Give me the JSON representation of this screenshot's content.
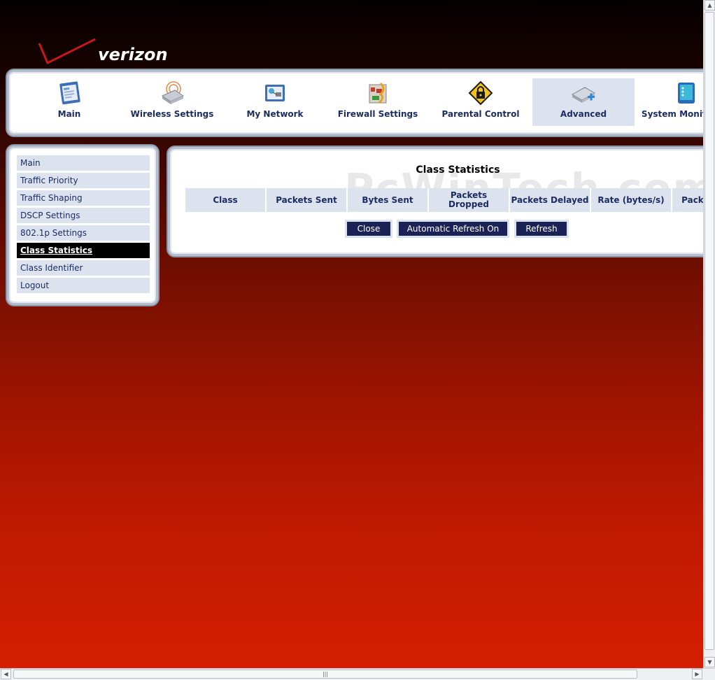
{
  "logo": {
    "text": "verizon"
  },
  "nav": {
    "items": [
      {
        "label": "Main",
        "icon": "main-icon"
      },
      {
        "label": "Wireless Settings",
        "icon": "wireless-icon"
      },
      {
        "label": "My Network",
        "icon": "network-icon"
      },
      {
        "label": "Firewall Settings",
        "icon": "firewall-icon"
      },
      {
        "label": "Parental Control",
        "icon": "lock-icon"
      },
      {
        "label": "Advanced",
        "icon": "advanced-icon",
        "active": true
      },
      {
        "label": "System Monitoring",
        "icon": "monitor-icon"
      }
    ]
  },
  "sidebar": {
    "items": [
      {
        "label": "Main"
      },
      {
        "label": "Traffic Priority"
      },
      {
        "label": "Traffic Shaping"
      },
      {
        "label": "DSCP Settings"
      },
      {
        "label": "802.1p Settings"
      },
      {
        "label": "Class Statistics",
        "active": true
      },
      {
        "label": "Class Identifier"
      },
      {
        "label": "Logout"
      }
    ]
  },
  "content": {
    "title": "Class Statistics",
    "watermark": "PcWinTech.com",
    "columns": [
      "Class",
      "Packets Sent",
      "Bytes Sent",
      "Packets Dropped",
      "Packets Delayed",
      "Rate (bytes/s)",
      "Packets Rate"
    ],
    "buttons": {
      "close": "Close",
      "auto_refresh": "Automatic Refresh On",
      "refresh": "Refresh"
    }
  },
  "colors": {
    "accent": "#1b2356",
    "nav_text": "#1b2d63",
    "panel_border": "#b7bfcf",
    "item_bg": "#dde2ef"
  }
}
